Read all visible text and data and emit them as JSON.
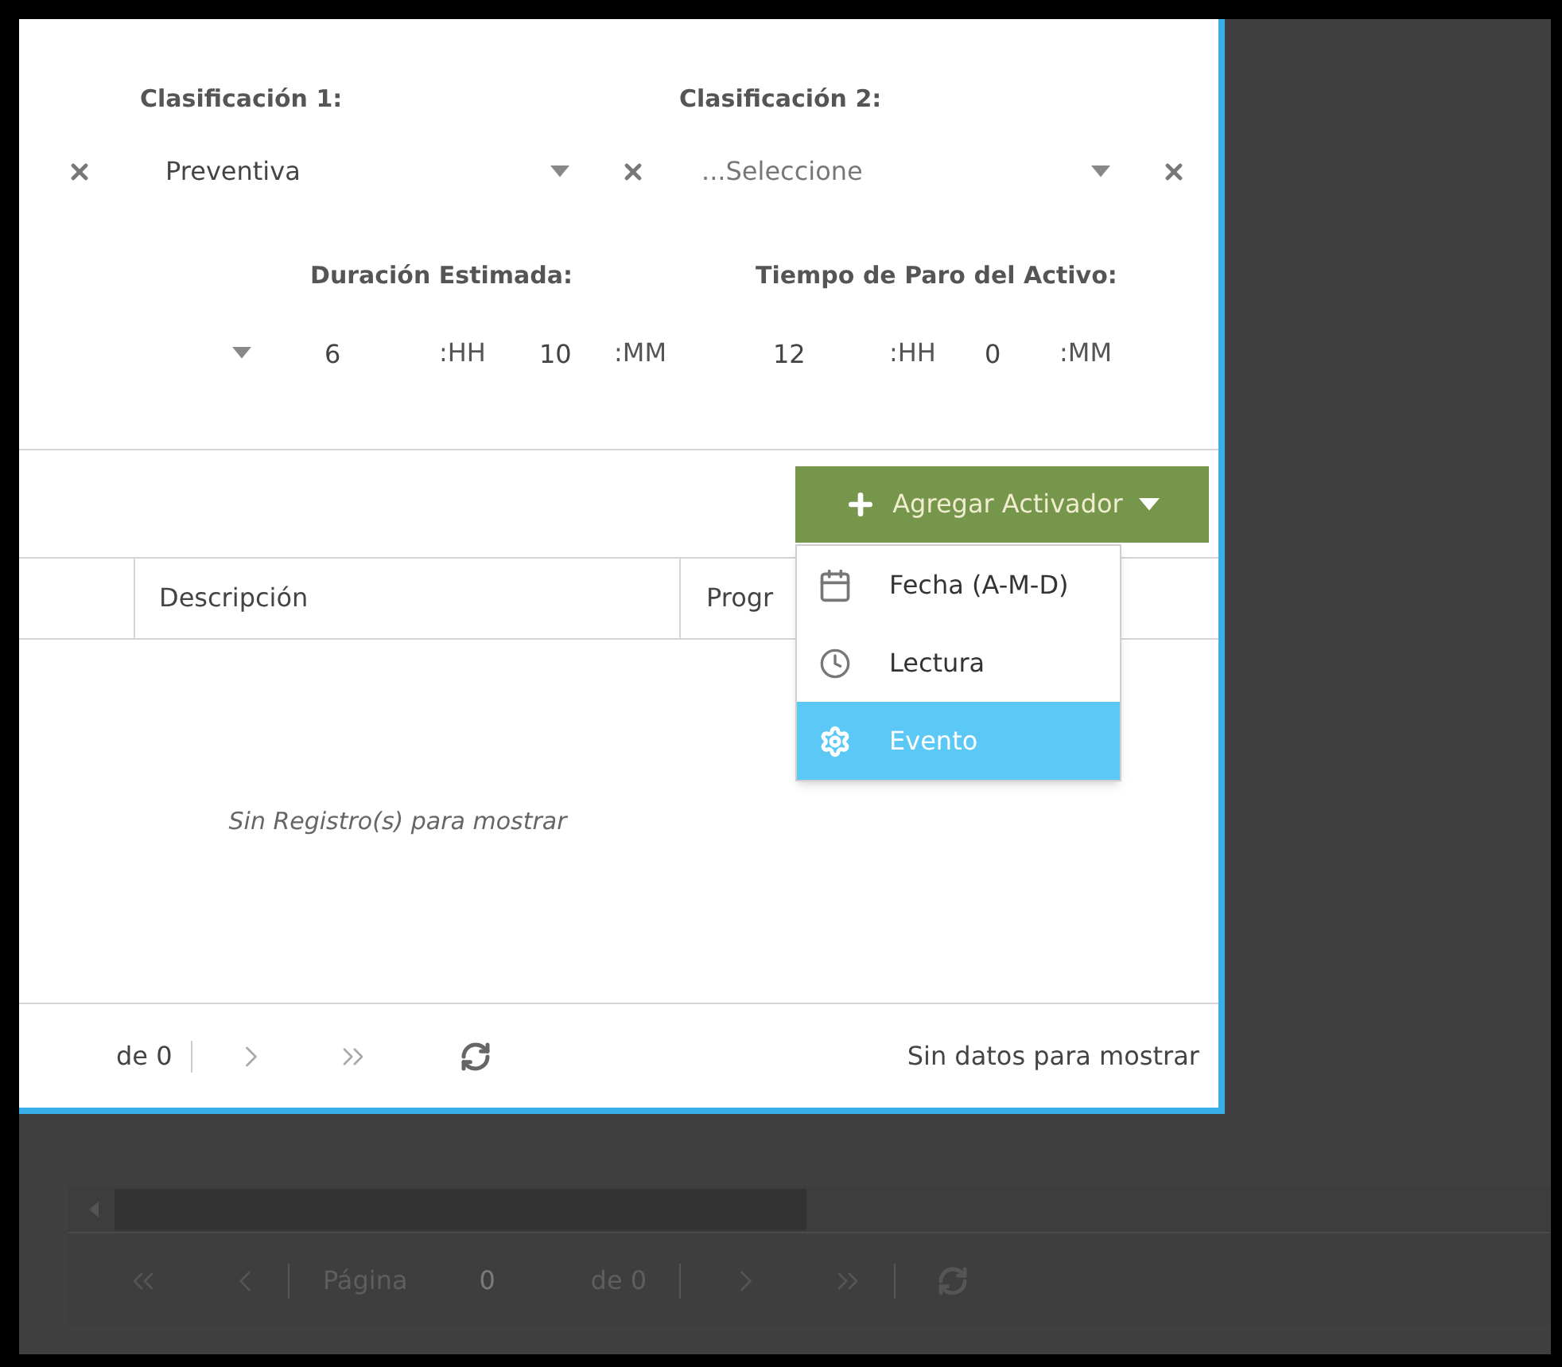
{
  "classifications": [
    {
      "label": "Clasificación 1:",
      "value": "Preventiva"
    },
    {
      "label": "Clasificación 2:",
      "placeholder": "...Seleccione"
    }
  ],
  "duration": {
    "label": "Duración Estimada:",
    "hours": "6",
    "hours_unit": ":HH",
    "minutes": "10",
    "minutes_unit": ":MM"
  },
  "downtime": {
    "label": "Tiempo de Paro del Activo:",
    "hours": "12",
    "hours_unit": ":HH",
    "minutes": "0",
    "minutes_unit": ":MM"
  },
  "add_button": {
    "label": "Agregar Activador"
  },
  "menu": [
    {
      "label": "Fecha (A-M-D)",
      "kind": "calendar",
      "selected": false
    },
    {
      "label": "Lectura",
      "kind": "clock",
      "selected": false
    },
    {
      "label": "Evento",
      "kind": "gear",
      "selected": true
    }
  ],
  "table": {
    "columns": [
      "Descripción",
      "Progr"
    ],
    "empty_message": "Sin Registro(s) para mostrar"
  },
  "pager": {
    "of_total": "de 0",
    "status": "Sin datos para mostrar"
  },
  "background_pager": {
    "page_label": "Página",
    "page_value": "0",
    "of_total": "de 0"
  }
}
